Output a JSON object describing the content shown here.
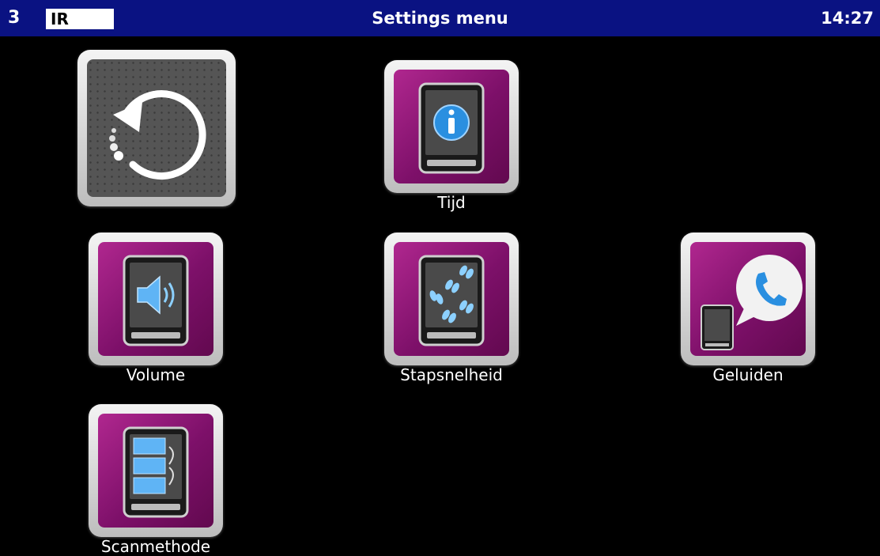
{
  "header": {
    "page_number": "3",
    "mode": "IR",
    "title": "Settings menu",
    "time": "14:27"
  },
  "tiles": {
    "back": {
      "label": "",
      "icon": "back-arrow-icon"
    },
    "tijd": {
      "label": "Tijd",
      "icon": "info-icon"
    },
    "volume": {
      "label": "Volume",
      "icon": "speaker-icon"
    },
    "stapsnelheid": {
      "label": "Stapsnelheid",
      "icon": "footsteps-icon"
    },
    "geluiden": {
      "label": "Geluiden",
      "icon": "phone-bubble-icon"
    },
    "scanmethode": {
      "label": "Scanmethode",
      "icon": "scan-list-icon"
    }
  },
  "colors": {
    "header_bg": "#0a1282",
    "tile_inner": "#8e1479",
    "background": "#000000"
  }
}
